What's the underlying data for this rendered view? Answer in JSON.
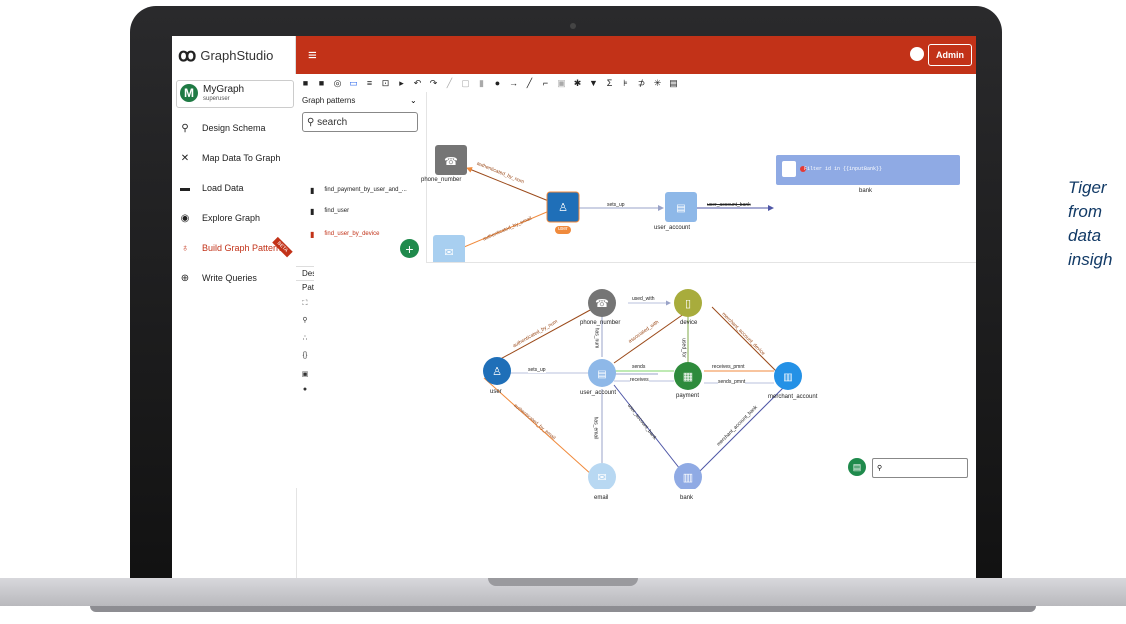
{
  "side_text": [
    "Tiger",
    "from",
    "data",
    "insigh"
  ],
  "app": {
    "brand_name": "GraphStudio",
    "admin_label": "Admin",
    "menu_glyph": "≡",
    "brand_logo_glyph": "ꝏ"
  },
  "graph_selector": {
    "badge": "M",
    "name": "MyGraph",
    "role": "superuser"
  },
  "nav": [
    {
      "label": "Design Schema",
      "icon": "schema-icon",
      "glyph": "⚲"
    },
    {
      "label": "Map Data To Graph",
      "icon": "map-icon",
      "glyph": "✕"
    },
    {
      "label": "Load Data",
      "icon": "load-icon",
      "glyph": "▬"
    },
    {
      "label": "Explore Graph",
      "icon": "explore-icon",
      "glyph": "◉"
    },
    {
      "label": "Build Graph Patterns",
      "icon": "bulb-icon",
      "glyph": "♁",
      "active": true,
      "badge": "BETA"
    },
    {
      "label": "Write Queries",
      "icon": "globe-icon",
      "glyph": "⊕"
    }
  ],
  "toolbar_glyphs": [
    "■",
    "■",
    "◎",
    "▭",
    "≡",
    "⊡",
    "▸",
    "↶",
    "↷",
    "╱",
    "▢",
    "▮",
    "●",
    "→",
    "╱",
    "⌐",
    "▣",
    "✱",
    "▼",
    "Σ",
    "⊧",
    "⊅",
    "✳",
    "▤"
  ],
  "patterns_panel": {
    "header": "Graph patterns",
    "search_placeholder": "search",
    "items": [
      {
        "label": "find_payment_by_user_and_...",
        "active": false
      },
      {
        "label": "find_user",
        "active": false
      },
      {
        "label": "find_user_by_device",
        "active": true
      }
    ],
    "add_glyph": "+",
    "description_label": "Description",
    "pattern_params_label": "Pattern parameters"
  },
  "top_canvas": {
    "nodes": [
      "phone_number",
      "user",
      "user_account",
      "email",
      "bank"
    ],
    "edges": [
      "authenticated_by_num",
      "sets_up",
      "user_account_bank",
      "authenticated_by_email"
    ],
    "user_tag": "user",
    "filter_text": "Filter id in {{inputBank}}"
  },
  "bottom_canvas": {
    "nodes": [
      "phone_number",
      "device",
      "user",
      "user_account",
      "payment",
      "merchant_account",
      "email",
      "bank"
    ],
    "edges": [
      "used_with",
      "has_num",
      "authenticated_by_num",
      "associated_with",
      "used_for",
      "merchant_account_device",
      "sets_up",
      "sends",
      "receives_pmnt",
      "receives",
      "sends_pmnt",
      "authenticated_by_email",
      "has_email",
      "user_account_bank",
      "merchant_account_bank"
    ]
  },
  "colors": {
    "primary": "#c23218",
    "green": "#1f8a4c"
  }
}
